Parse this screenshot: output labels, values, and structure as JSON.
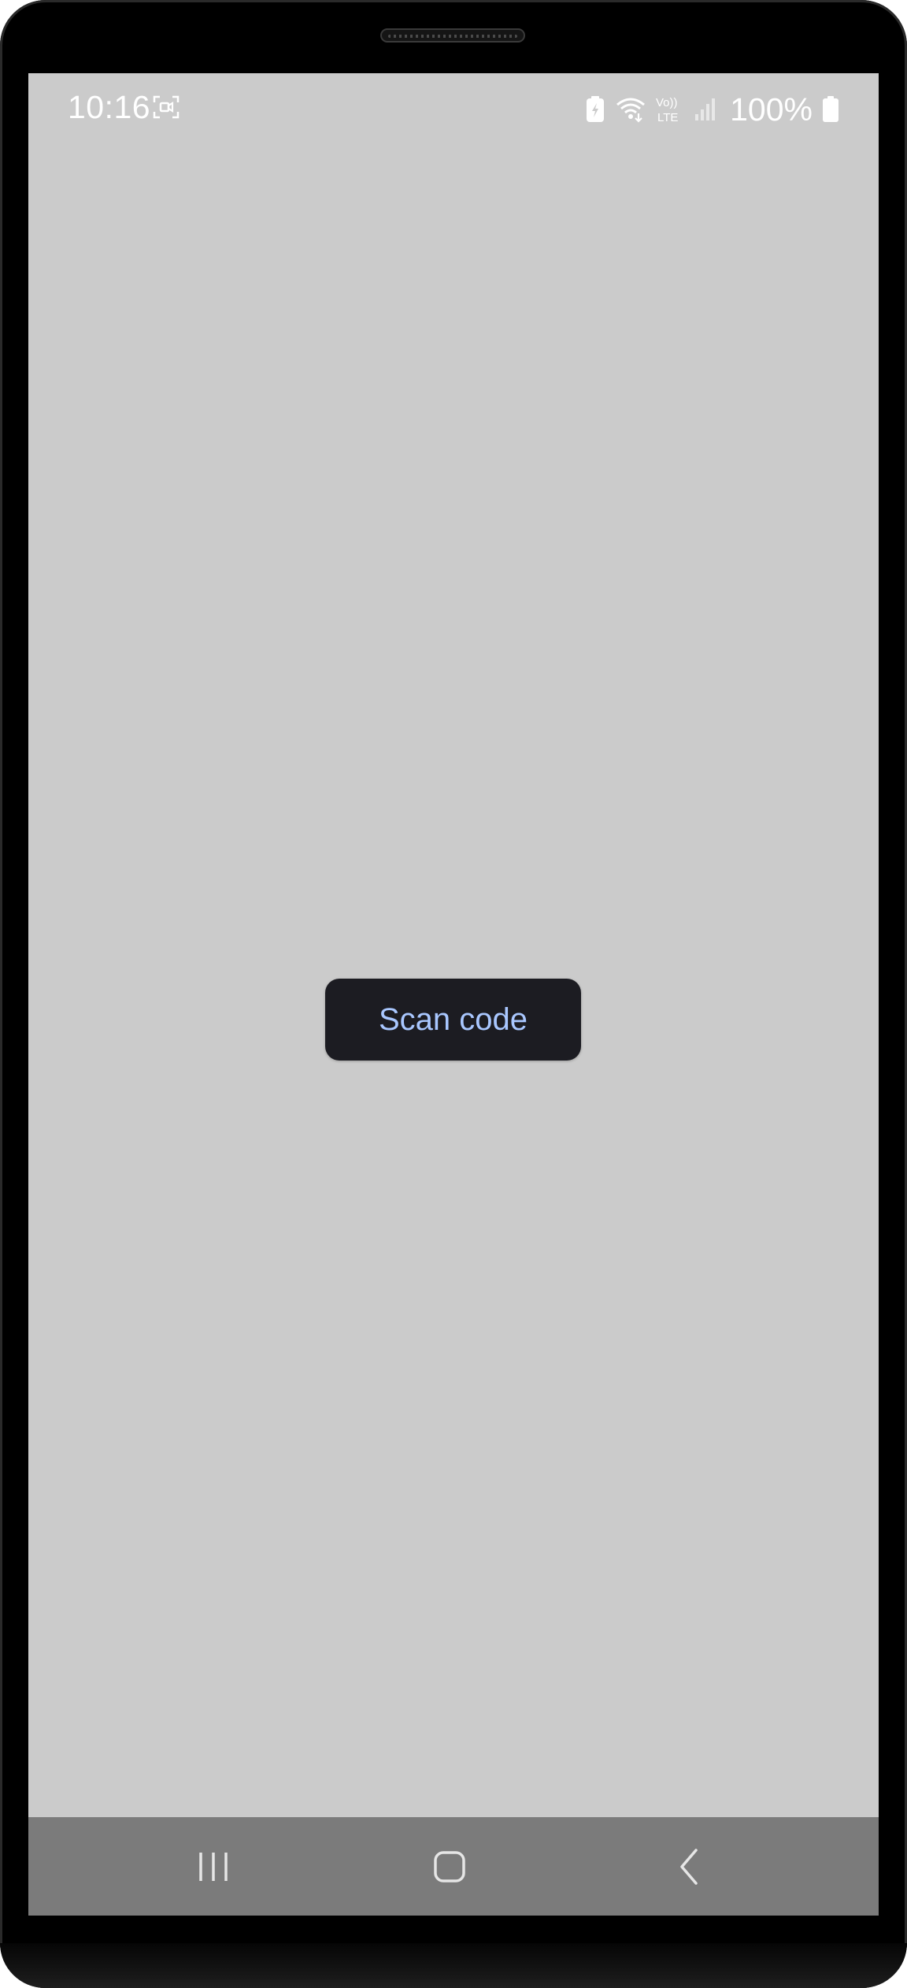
{
  "status_bar": {
    "time": "10:16",
    "battery_percent": "100%",
    "network_label_top": "Vo))",
    "network_label_bottom": "LTE",
    "icons": [
      "screen-record-icon",
      "battery-saver-icon",
      "wifi-icon",
      "volte-icon",
      "signal-icon",
      "battery-icon"
    ]
  },
  "main": {
    "scan_button_label": "Scan code"
  },
  "nav_bar": {
    "icons": [
      "recents-icon",
      "home-icon",
      "back-icon"
    ]
  },
  "colors": {
    "screen_background": "#cbcbcb",
    "button_background": "#1c1c22",
    "button_text": "#a9c7ff",
    "nav_bar": "#7b7b7b"
  }
}
